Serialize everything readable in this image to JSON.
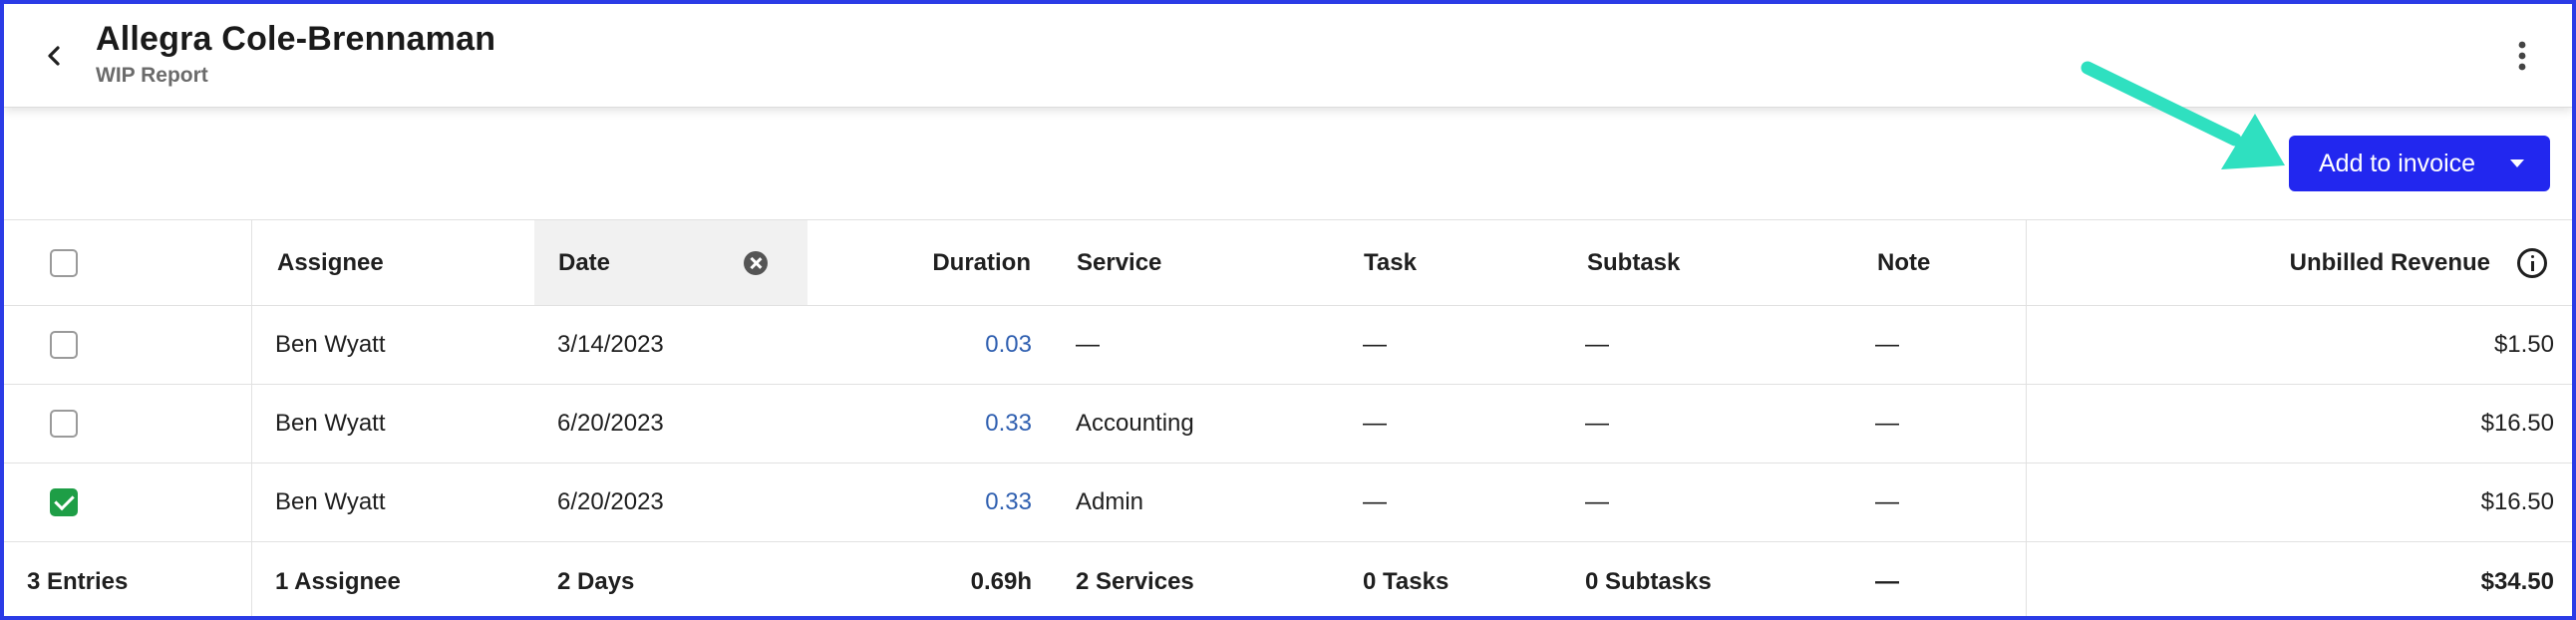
{
  "header": {
    "title": "Allegra Cole-Brennaman",
    "subtitle": "WIP Report",
    "back_icon": "chevron-left-icon",
    "menu_icon": "more-vertical-icon"
  },
  "toolbar": {
    "add_to_invoice_label": "Add to invoice",
    "accent_color": "#2227ef"
  },
  "table": {
    "columns": {
      "assignee": "Assignee",
      "date": "Date",
      "duration": "Duration",
      "service": "Service",
      "task": "Task",
      "subtask": "Subtask",
      "note": "Note",
      "unbilled_revenue": "Unbilled Revenue"
    },
    "rows": [
      {
        "checked": false,
        "assignee": "Ben Wyatt",
        "date": "3/14/2023",
        "duration": "0.03",
        "service": "—",
        "task": "—",
        "subtask": "—",
        "note": "—",
        "unbilled_revenue": "$1.50"
      },
      {
        "checked": false,
        "assignee": "Ben Wyatt",
        "date": "6/20/2023",
        "duration": "0.33",
        "service": "Accounting",
        "task": "—",
        "subtask": "—",
        "note": "—",
        "unbilled_revenue": "$16.50"
      },
      {
        "checked": true,
        "assignee": "Ben Wyatt",
        "date": "6/20/2023",
        "duration": "0.33",
        "service": "Admin",
        "task": "—",
        "subtask": "—",
        "note": "—",
        "unbilled_revenue": "$16.50"
      }
    ],
    "footer": {
      "entries": "3 Entries",
      "assignee": "1 Assignee",
      "date": "2 Days",
      "duration": "0.69h",
      "service": "2 Services",
      "task": "0 Tasks",
      "subtask": "0 Subtasks",
      "note": "—",
      "unbilled_revenue": "$34.50"
    }
  },
  "colors": {
    "frame_border": "#2b3be6",
    "annotation_arrow": "#2fe0c0",
    "checked_green": "#1e9e46",
    "duration_link": "#2f5fb0"
  }
}
